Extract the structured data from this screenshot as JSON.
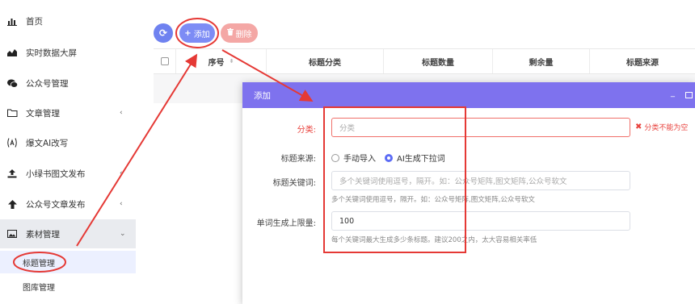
{
  "sidebar": {
    "items": [
      {
        "label": "首页",
        "icon": "bar-chart-icon"
      },
      {
        "label": "实时数据大屏",
        "icon": "area-chart-icon"
      },
      {
        "label": "公众号管理",
        "icon": "wechat-icon"
      },
      {
        "label": "文章管理",
        "icon": "folder-icon",
        "chevron": "‹"
      },
      {
        "label": "爆文AI改写",
        "icon": "ai-icon"
      },
      {
        "label": "小绿书图文发布",
        "icon": "upload-icon",
        "chevron": "‹"
      },
      {
        "label": "公众号文章发布",
        "icon": "arrow-up-icon",
        "chevron": "‹"
      },
      {
        "label": "素材管理",
        "icon": "image-icon",
        "chevron": "⌄"
      }
    ],
    "sub_items": [
      {
        "label": "标题管理",
        "active": true
      },
      {
        "label": "图库管理",
        "active": false
      }
    ]
  },
  "toolbar": {
    "refresh_icon": "⟳",
    "add_label": "添加",
    "add_icon": "+",
    "delete_label": "删除",
    "delete_icon": "🗑"
  },
  "table": {
    "columns": [
      "序号",
      "标题分类",
      "标题数量",
      "剩余量",
      "标题来源"
    ]
  },
  "dialog": {
    "title": "添加",
    "min_icon": "_",
    "fields": {
      "category": {
        "label": "分类:",
        "placeholder": "分类",
        "error": "分类不能为空",
        "error_icon": "✖"
      },
      "source": {
        "label": "标题来源:",
        "options": [
          "手动导入",
          "AI生成下拉词"
        ],
        "selected": "AI生成下拉词"
      },
      "keywords": {
        "label": "标题关键词:",
        "placeholder": "多个关键词使用逗号，隔开。如：公众号矩阵,图文矩阵,公众号软文",
        "hint": "多个关键词使用逗号，隔开。如：公众号矩阵,图文矩阵,公众号软文"
      },
      "limit": {
        "label": "单词生成上限量:",
        "value": "100",
        "hint": "每个关键词最大生成多少条标题。建议200之内，太大容易相关率低"
      }
    }
  },
  "colors": {
    "accent": "#7e72ee",
    "primary_button": "#7d8cf5",
    "danger_button": "#f4a7a5",
    "error": "#e8413c",
    "annotation": "#e53935"
  }
}
